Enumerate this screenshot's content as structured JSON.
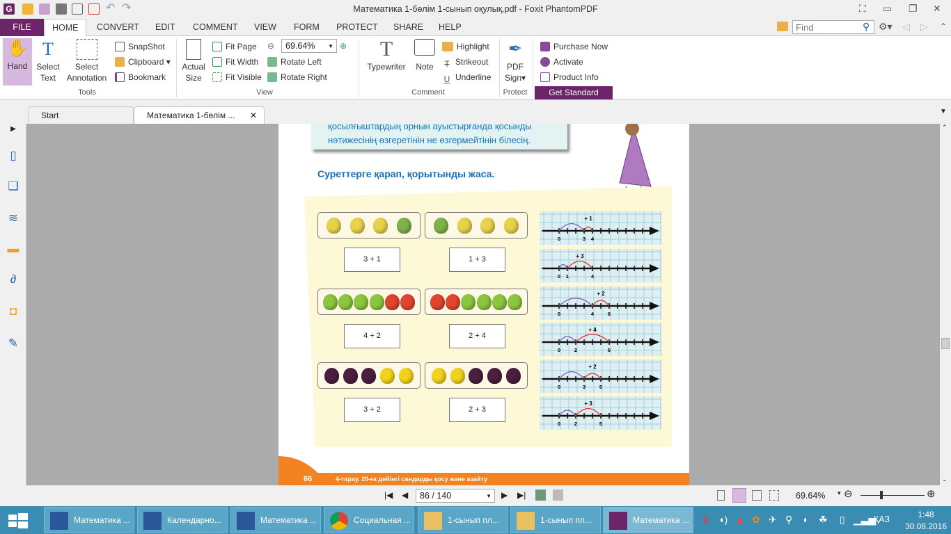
{
  "window": {
    "title": "Математика 1-бөлім 1-сынып оқулық.pdf - Foxit PhantomPDF"
  },
  "menu": {
    "file": "FILE",
    "tabs": [
      "HOME",
      "CONVERT",
      "EDIT",
      "COMMENT",
      "VIEW",
      "FORM",
      "PROTECT",
      "SHARE",
      "HELP"
    ],
    "find_placeholder": "Find"
  },
  "ribbon": {
    "tools": {
      "hand": "Hand",
      "select_text": [
        "Select",
        "Text"
      ],
      "select_annotation": [
        "Select",
        "Annotation"
      ],
      "snapshot": "SnapShot",
      "clipboard": "Clipboard",
      "bookmark": "Bookmark",
      "label": "Tools"
    },
    "view": {
      "actual_size": [
        "Actual",
        "Size"
      ],
      "fit_page": "Fit Page",
      "fit_width": "Fit Width",
      "fit_visible": "Fit Visible",
      "zoom": "69.64%",
      "rotate_left": "Rotate Left",
      "rotate_right": "Rotate Right",
      "label": "View"
    },
    "comment": {
      "typewriter": "Typewriter",
      "note": "Note",
      "highlight": "Highlight",
      "strikeout": "Strikeout",
      "underline": "Underline",
      "label": "Comment"
    },
    "protect": {
      "pdf_sign": [
        "PDF",
        "Sign"
      ],
      "label": "Protect"
    },
    "standard": {
      "purchase": "Purchase Now",
      "activate": "Activate",
      "product_info": "Product Info",
      "get_standard": "Get Standard"
    }
  },
  "doc_tabs": [
    "Start",
    "Математика 1-бөлім ..."
  ],
  "page": {
    "info": [
      "қосылғыштардың орнын ауыстырғанда қосынды",
      "нәтижесінің өзгеретінін не өзгермейтінін білесің."
    ],
    "heading": "Суреттерге қарап, қорытынды жаса.",
    "rows": [
      {
        "left": [
          "#e8d24a",
          "#e8d24a",
          "#e8d24a",
          "#7fb34a"
        ],
        "right": [
          "#7fb34a",
          "#e8d24a",
          "#e8d24a",
          "#e8d24a"
        ],
        "expr": [
          "3 + 1",
          "1 + 3"
        ]
      },
      {
        "left": [
          "#8cc63f",
          "#8cc63f",
          "#8cc63f",
          "#8cc63f",
          "#e2452e",
          "#e2452e"
        ],
        "right": [
          "#e2452e",
          "#e2452e",
          "#8cc63f",
          "#8cc63f",
          "#8cc63f",
          "#8cc63f"
        ],
        "expr": [
          "4 + 2",
          "2 + 4"
        ]
      },
      {
        "left": [
          "#4a1f3f",
          "#4a1f3f",
          "#4a1f3f",
          "#f2d21c",
          "#f2d21c"
        ],
        "right": [
          "#f2d21c",
          "#f2d21c",
          "#4a1f3f",
          "#4a1f3f",
          "#4a1f3f"
        ],
        "expr": [
          "3 + 2",
          "2 + 3"
        ]
      }
    ],
    "number_lines": [
      {
        "a": 3,
        "b": 1,
        "label": "+ 1",
        "marks": [
          "0",
          "3",
          "4"
        ]
      },
      {
        "a": 1,
        "b": 3,
        "label": "+ 3",
        "marks": [
          "0",
          "1",
          "4"
        ]
      },
      {
        "a": 4,
        "b": 2,
        "label": "+ 2",
        "marks": [
          "0",
          "4",
          "6"
        ]
      },
      {
        "a": 2,
        "b": 4,
        "label": "+ 4",
        "marks": [
          "0",
          "2",
          "6"
        ]
      },
      {
        "a": 3,
        "b": 2,
        "label": "+ 2",
        "marks": [
          "0",
          "3",
          "5"
        ]
      },
      {
        "a": 2,
        "b": 3,
        "label": "+ 3",
        "marks": [
          "0",
          "2",
          "5"
        ]
      }
    ],
    "footer": {
      "page_number": "86",
      "chapter": "4-тарау. 20-ға дейінгі сандарды қосу және азайту"
    }
  },
  "nav": {
    "page": "86 / 140",
    "zoom": "69.64%",
    "zoom_fraction": 0.3
  },
  "taskbar": {
    "items": [
      "Математика ...",
      "Календарно...",
      "Математика ...",
      "Социальная ...",
      "1-сынып пл...",
      "1-сынып пл...",
      "Математика ..."
    ],
    "lang": "ҚАЗ",
    "time": "1:48",
    "date": "30.08.2016"
  },
  "colors": {
    "accent": "#6b2568",
    "orange": "#f58220",
    "blue_text": "#1a6fb4"
  }
}
